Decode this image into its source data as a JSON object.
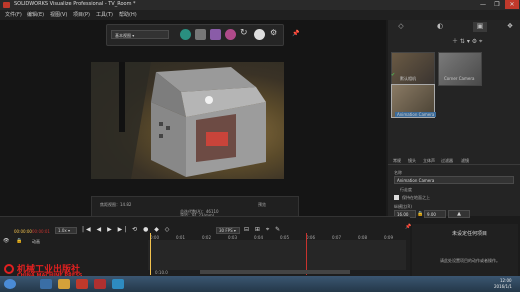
{
  "window": {
    "title": "SOLIDWORKS Visualize Professional - TV_Room *",
    "min": "—",
    "max": "❐",
    "close": "✕"
  },
  "menu": [
    "文件(F)",
    "编辑(E)",
    "视图(V)",
    "项目(P)",
    "工具(T)",
    "帮助(H)"
  ],
  "toolbar": {
    "camera_select": "基本视图 ▾"
  },
  "viewport_status": {
    "fov": "焦距视图：14.82",
    "sample": "总迭代数(A)：46110",
    "time": "渲染：91.23(mm)",
    "mode": "预览"
  },
  "right_panel": {
    "cameras": [
      {
        "label": "默认相机",
        "active": true
      },
      {
        "label": "Corner Camera",
        "active": false
      },
      {
        "label": "Animation Camera",
        "active": false,
        "selected": true
      }
    ],
    "property_tabs": [
      "常规",
      "镜头",
      "立体声",
      "过滤器",
      "滤镜"
    ],
    "name_label": "名称",
    "name_value": "Animation Camera",
    "type_label": "行走度",
    "checkbox_label": "保持在地面之上",
    "ratio_label": "纵横比(R)",
    "ratio_w": "16.00",
    "ratio_h": "9.00",
    "lock": "🔒"
  },
  "timeline": {
    "timecode_a": "00:00:00",
    "timecode_b": "00:00:01",
    "fps": "30 FPS ▾",
    "speed": "1.0x ▾",
    "ticks": [
      "0:00",
      "0:01",
      "0:02",
      "0:03",
      "0:04",
      "0:05",
      "0:06",
      "0:07",
      "0:08",
      "0:09"
    ],
    "track_label": "动画",
    "footer": "0:10.0"
  },
  "notification": {
    "title": "未设定任何项目",
    "body": "请此处设置项目的动作或者操作。"
  },
  "watermark": {
    "cn": "机械工业出版社",
    "en": "CHINA MACHINE PRESS"
  },
  "taskbar": {
    "time": "12:00",
    "date": "2016/1/1"
  },
  "colors": {
    "accent_red": "#c8332e",
    "playhead": "#f2c14e",
    "taskbar": "#2e4760"
  }
}
